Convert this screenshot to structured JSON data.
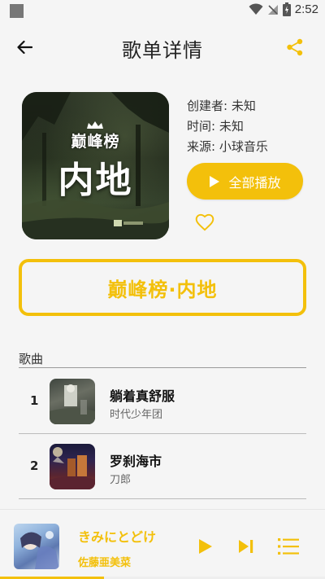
{
  "status_bar": {
    "time": "2:52"
  },
  "header": {
    "title": "歌单详情"
  },
  "playlist": {
    "cover_brand": "巅峰榜",
    "cover_name": "内地",
    "creator": "创建者: 未知",
    "time": "时间: 未知",
    "source": "来源: 小球音乐",
    "play_all_label": "全部播放",
    "name": "巅峰榜·内地"
  },
  "songs_section": {
    "label": "歌曲",
    "items": [
      {
        "index": "1",
        "title": "躺着真舒服",
        "artist": "时代少年团"
      },
      {
        "index": "2",
        "title": "罗刹海市",
        "artist": "刀郎"
      }
    ]
  },
  "player": {
    "title": "きみにとどけ",
    "artist": "佐藤亜美菜",
    "progress": 0.32
  },
  "colors": {
    "accent": "#f3c00b",
    "background": "#f5f5f5"
  }
}
